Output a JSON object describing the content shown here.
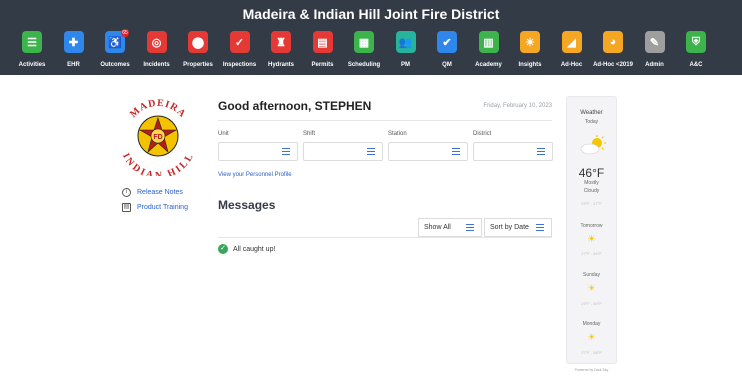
{
  "header": {
    "title": "Madeira & Indian Hill Joint Fire District",
    "modules": [
      {
        "label": "Activities",
        "icon": "clipboard-list-icon",
        "color": "#3cb44b",
        "glyph": "☰"
      },
      {
        "label": "EHR",
        "icon": "medical-cross-icon",
        "color": "#2f86eb",
        "glyph": "✚"
      },
      {
        "label": "Outcomes",
        "icon": "person-outcomes-icon",
        "color": "#2f86eb",
        "glyph": "♿",
        "badge": "65"
      },
      {
        "label": "Incidents",
        "icon": "lifebuoy-icon",
        "color": "#e53935",
        "glyph": "◎"
      },
      {
        "label": "Properties",
        "icon": "map-pin-icon",
        "color": "#e53935",
        "glyph": "⬤"
      },
      {
        "label": "Inspections",
        "icon": "clipboard-check-icon",
        "color": "#e53935",
        "glyph": "✓"
      },
      {
        "label": "Hydrants",
        "icon": "hydrant-icon",
        "color": "#e53935",
        "glyph": "♜"
      },
      {
        "label": "Permits",
        "icon": "permit-document-icon",
        "color": "#e53935",
        "glyph": "▤"
      },
      {
        "label": "Scheduling",
        "icon": "calendar-icon",
        "color": "#3cb44b",
        "glyph": "▦"
      },
      {
        "label": "PM",
        "icon": "people-icon",
        "color": "#26b59a",
        "glyph": "👥"
      },
      {
        "label": "QM",
        "icon": "checkmark-icon",
        "color": "#2f86eb",
        "glyph": "✔"
      },
      {
        "label": "Academy",
        "icon": "book-icon",
        "color": "#3cb44b",
        "glyph": "▥"
      },
      {
        "label": "Insights",
        "icon": "lightbulb-icon",
        "color": "#f5a623",
        "glyph": "☀"
      },
      {
        "label": "Ad-Hoc",
        "icon": "chart-triangle-icon",
        "color": "#f5a623",
        "glyph": "◢"
      },
      {
        "label": "Ad-Hoc <2019",
        "icon": "chart-circle-icon",
        "color": "#f5a623",
        "glyph": "◕"
      },
      {
        "label": "Admin",
        "icon": "wrench-icon",
        "color": "#9e9e9e",
        "glyph": "✎"
      },
      {
        "label": "A&C",
        "icon": "shield-check-icon",
        "color": "#3cb44b",
        "glyph": "⛨"
      }
    ]
  },
  "logo": {
    "top_text": "MADEIRA",
    "bottom_text": "INDIAN HILL",
    "center_text": "FD"
  },
  "sidebar": {
    "links": [
      {
        "label": "Release Notes",
        "icon": "info-circle-icon"
      },
      {
        "label": "Product Training",
        "icon": "training-book-icon"
      }
    ]
  },
  "main": {
    "greeting": "Good afternoon, STEPHEN",
    "date": "Friday, February 10, 2023",
    "filters": [
      {
        "label": "Unit",
        "value": ""
      },
      {
        "label": "Shift",
        "value": ""
      },
      {
        "label": "Station",
        "value": ""
      },
      {
        "label": "District",
        "value": ""
      }
    ],
    "profile_link": "View your Personnel Profile",
    "messages_title": "Messages",
    "show_all": "Show All",
    "sort_by": "Sort by Date",
    "empty_message": "All caught up!"
  },
  "weather": {
    "title": "Weather",
    "today_label": "Today",
    "current_temp": "46°F",
    "condition": "Mostly Cloudy",
    "today_range": "24°F - 47°F",
    "forecast": [
      {
        "day": "Tomorrow",
        "range": "27°F - 45°F",
        "icon": "sun-icon"
      },
      {
        "day": "Sunday",
        "range": "29°F - 54°F",
        "icon": "partly-sunny-icon"
      },
      {
        "day": "Monday",
        "range": "27°F - 58°F",
        "icon": "partly-sunny-icon"
      }
    ],
    "powered_by": "Powered by Dark Sky"
  }
}
